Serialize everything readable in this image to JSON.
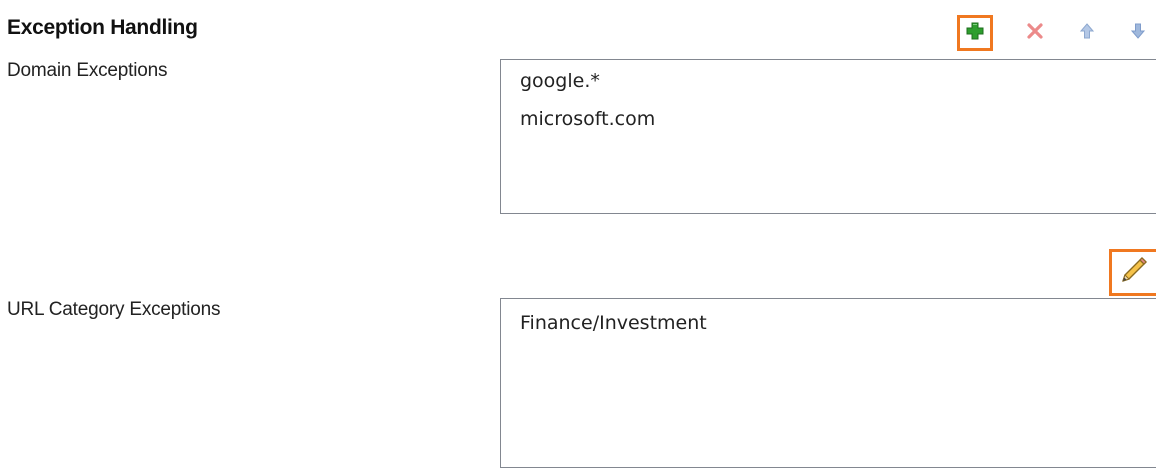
{
  "section": {
    "title": "Exception Handling"
  },
  "domain_exceptions": {
    "label": "Domain Exceptions",
    "items": [
      "google.*",
      "microsoft.com"
    ]
  },
  "url_category_exceptions": {
    "label": "URL Category Exceptions",
    "items": [
      "Finance/Investment"
    ]
  },
  "toolbar": {
    "buttons": [
      {
        "icon": "plus-icon",
        "enabled": true,
        "highlighted": true
      },
      {
        "icon": "delete-x-icon",
        "enabled": false
      },
      {
        "icon": "arrow-up-icon",
        "enabled": false
      },
      {
        "icon": "arrow-down-icon",
        "enabled": false
      }
    ]
  },
  "edit_button": {
    "icon": "pencil-icon",
    "highlighted": true
  },
  "colors": {
    "highlight_border": "#f07820",
    "plus_green": "#2e9e2e",
    "delete_red": "#ec8a8a",
    "arrow_blue": "#9fb8dc",
    "listbox_border": "#828790"
  }
}
